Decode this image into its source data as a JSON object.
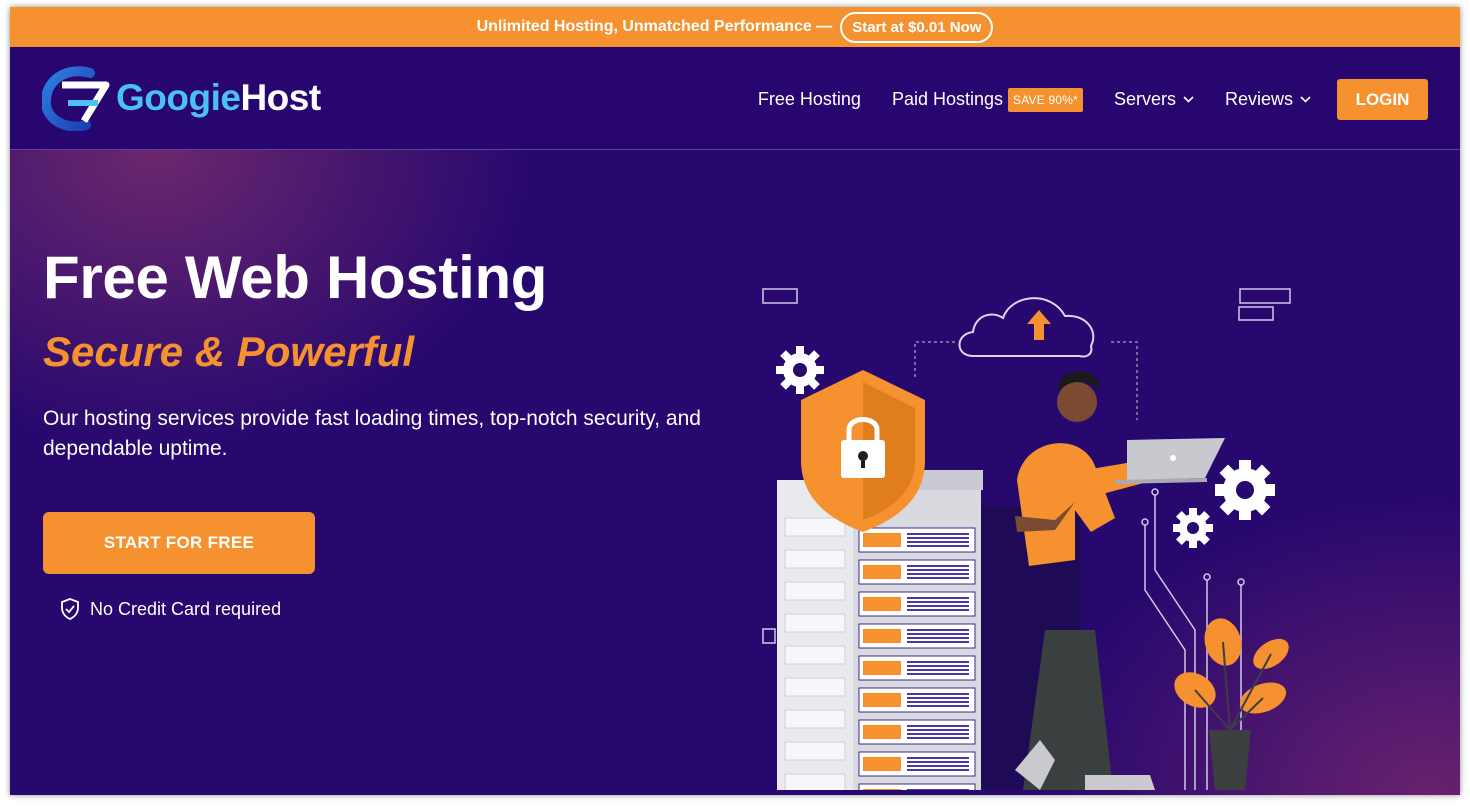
{
  "promo": {
    "text": "Unlimited Hosting, Unmatched Performance —",
    "cta_label": "Start at $0.01 Now"
  },
  "header": {
    "logo": {
      "part1": "Googie",
      "part2": "Host",
      "icon": "googiehost-logo-icon"
    },
    "nav": [
      {
        "label": "Free Hosting"
      },
      {
        "label": "Paid Hostings",
        "badge": "SAVE 90%*"
      },
      {
        "label": "Servers",
        "icon": "chevron-down-icon"
      },
      {
        "label": "Reviews",
        "icon": "chevron-down-icon"
      }
    ],
    "login_label": "LOGIN"
  },
  "hero": {
    "title": "Free Web Hosting",
    "subtitle": "Secure & Powerful",
    "description": "Our hosting services provide fast loading times, top-notch security, and dependable uptime.",
    "cta_label": "START FOR FREE",
    "note": "No Credit Card required",
    "note_icon": "shield-check-icon",
    "illustration_icons": [
      "cloud-upload-icon",
      "shield-lock-icon",
      "gear-icon",
      "server-rack-icon",
      "laptop-icon",
      "plant-icon"
    ]
  },
  "colors": {
    "accent": "#f5922f",
    "background": "#27086e",
    "logo_blue": "#4bc0f7"
  }
}
